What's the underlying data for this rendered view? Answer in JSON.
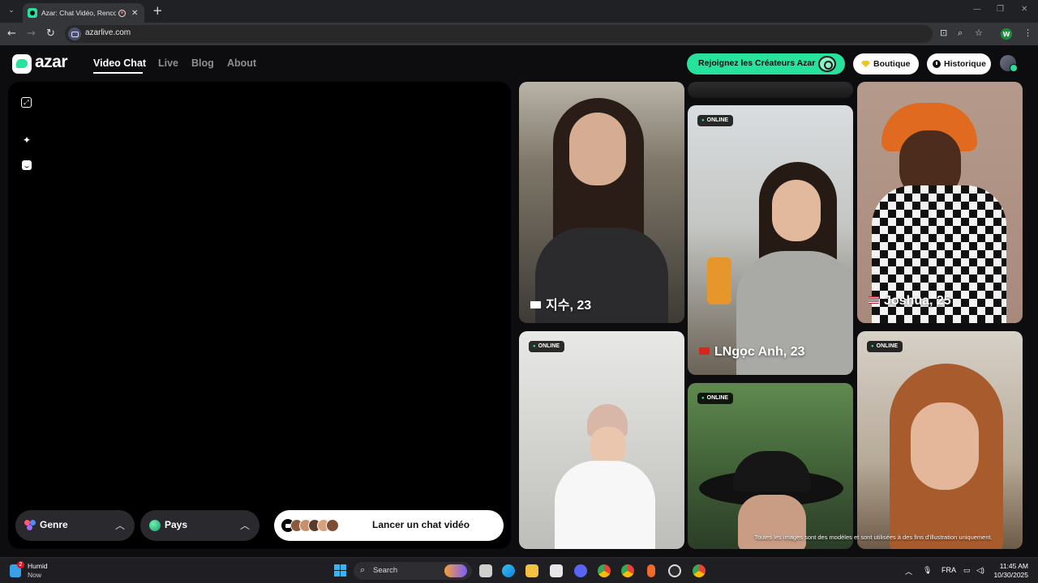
{
  "browser": {
    "tab_title": "Azar: Chat Vidéo, Rencontres",
    "new_tab": "+",
    "url": "azarlive.com",
    "profile_initial": "W"
  },
  "header": {
    "logo": "azar",
    "nav": [
      "Video Chat",
      "Live",
      "Blog",
      "About"
    ],
    "active_nav": "Video Chat",
    "creators_button": "Rejoignez les Créateurs Azar",
    "shop_button": "Boutique",
    "history_button": "Historique"
  },
  "video_panel": {
    "gender_filter": "Genre",
    "country_filter": "Pays",
    "start_button": "Lancer un chat vidéo"
  },
  "profiles": [
    {
      "name": "지수, 23",
      "country": "KR",
      "online": false
    },
    {
      "name": "LNgọc Anh, 23",
      "country": "VN",
      "online": true
    },
    {
      "name": "Joshua, 25",
      "country": "US",
      "online": false
    },
    {
      "name": "",
      "online": true
    },
    {
      "name": "",
      "online": true
    },
    {
      "name": "",
      "online": true
    }
  ],
  "online_badge": "ONLINE",
  "disclaimer": "Toutes les images sont des modèles et sont utilisées à des fins d'illustration uniquement.",
  "taskbar": {
    "weather_title": "Humid",
    "weather_sub": "Now",
    "weather_badge": "2",
    "search_placeholder": "Search",
    "language": "FRA",
    "time": "11:45 AM",
    "date": "10/30/2025"
  },
  "colors": {
    "accent": "#26e29c",
    "background": "#0d0d0f",
    "panel": "#000000"
  }
}
